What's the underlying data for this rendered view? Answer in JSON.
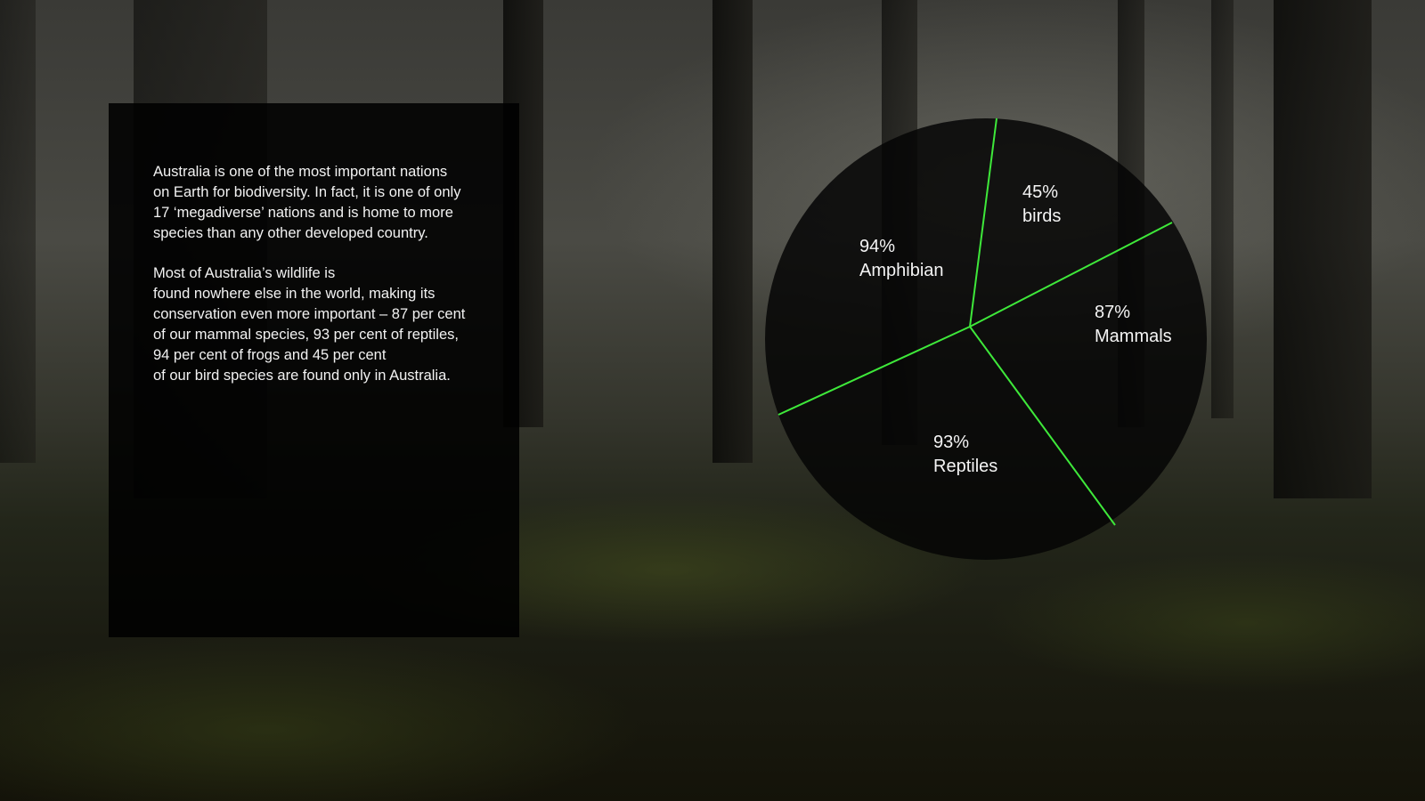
{
  "panel": {
    "paragraph_1": "Australia is one of the most important nations\non Earth for biodiversity. In fact, it is one of only\n17 ‘megadiverse’ nations and is home to more\nspecies than any other developed country.",
    "paragraph_2": "Most of Australia’s wildlife is\nfound nowhere else in the world, making its\nconservation even more important – 87 per cent\nof our mammal species, 93 per cent of reptiles,\n94 per cent of frogs and 45 per cent\nof our bird species are found only in Australia."
  },
  "chart_data": {
    "type": "pie",
    "categories": [
      "birds",
      "Mammals",
      "Reptiles",
      "Amphibian"
    ],
    "values": [
      45,
      87,
      93,
      94
    ],
    "value_labels": [
      "45%",
      "87%",
      "93%",
      "94%"
    ],
    "unit": "%",
    "colors": {
      "fill": "#0a0a0a",
      "divider": "#3ee83a",
      "label": "#f4f4f4"
    }
  }
}
